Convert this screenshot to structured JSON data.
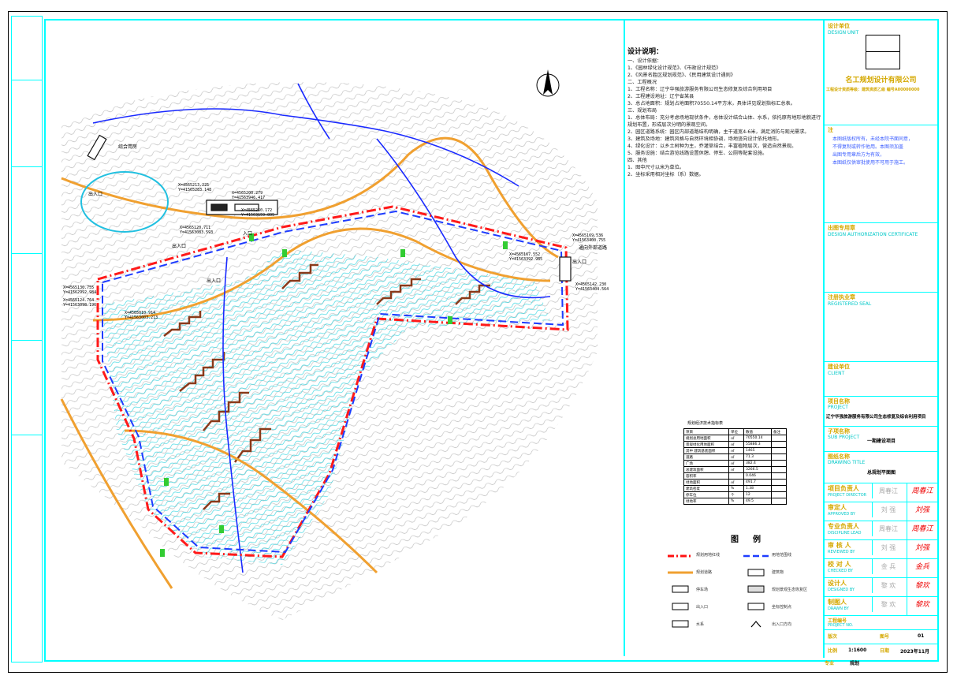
{
  "map": {
    "north_arrow": "N",
    "coords": [
      "X=4565213.225",
      "Y=41565283.148",
      "X=4565200.279",
      "Y=41563946.417",
      "X=4565250.172",
      "Y=41563159.895",
      "X=4565120.711",
      "Y=41563083.593",
      "X=4565169.536",
      "Y=41563400.755",
      "X=4565167.552",
      "Y=41563392.985",
      "X=4565142.230",
      "Y=41563404.564",
      "X=4565130.755",
      "Y=41562992.984",
      "X=4565124.764",
      "Y=41563098.196",
      "X=4565010.914",
      "Y=41563003.213"
    ],
    "labels": [
      "综合用房",
      "入口",
      "出入口",
      "出入口",
      "出入口",
      "出入口",
      "通向外部道路"
    ]
  },
  "notes": {
    "title": "设计说明：",
    "sections": [
      "一、设计依据：",
      "1、《园林绿化设计规范》、《市政设计规范》",
      "2、《风景名胜区规划规范》、《民用建筑设计通则》",
      "二、工程概况",
      "1、工程名称：辽宁华强旅游服务有限公司生态修复及综合利用项目",
      "2、工程建设地址：辽宁省某县",
      "3、总占地面积：规划占地面积70550.14平方米，具体详见规划指标汇总表。",
      "三、规划布局",
      "1、总体布局：充分考虑场地现状条件，总体设计结合山体、水系，依托原有地形地貌进行规划布置，形成层次分明的景观空间。",
      "2、园区道路系统：园区内部道路结构明确，主干道宽4-6米，满足消防与观光需求。",
      "3、建筑及场地：建筑风格与自然环境相协调，场地竖向设计依托地形。",
      "4、绿化设计：以乡土树种为主，乔灌草结合，丰富植物层次，营造自然景观。",
      "5、服务设施：结合游览线路设置休憩、停车、公厕等配套设施。",
      "四、其他",
      "1、图中尺寸以米为单位。",
      "2、坐标采用相对坐标（系）数据。"
    ]
  },
  "stats": {
    "title": "规划经济技术指标表",
    "header": [
      "项目",
      "单位",
      "数值",
      "备注"
    ],
    "rows": [
      [
        "规划总用地面积",
        "㎡",
        "70550.14",
        ""
      ],
      [
        "景观绿化用地面积",
        "㎡",
        "55886.3",
        ""
      ],
      [
        "其中 建筑基底面积",
        "㎡",
        "1465",
        ""
      ],
      [
        "道路",
        "㎡",
        "71.3",
        ""
      ],
      [
        "广场",
        "㎡",
        "382.4",
        ""
      ],
      [
        "总建筑面积",
        "㎡",
        "3266.5",
        ""
      ],
      [
        "容积率",
        "",
        "0.046",
        ""
      ],
      [
        "绿地面积",
        "㎡",
        "491.7",
        ""
      ],
      [
        "建筑密度",
        "%",
        "1.38",
        ""
      ],
      [
        "停车位",
        "个",
        "12",
        ""
      ],
      [
        "绿地率",
        "%",
        "49.5",
        ""
      ]
    ]
  },
  "legend": {
    "title": "图例",
    "items": [
      "规划用地红线",
      "用地范围线",
      "规划道路",
      "建筑物",
      "停车场",
      "规划景观生态恢复区",
      "出入口",
      "坐标控制点",
      "水系",
      "出入口方向"
    ]
  },
  "titleblock": {
    "design_unit_label": "设计单位",
    "design_unit_en": "DESIGN UNIT",
    "company": "名工规划设计有限公司",
    "cert": "工程设计资质等级：建筑资质乙级 编号A00000000",
    "notice_label": "注",
    "notice_lines": [
      "本图纸版权所有，未经本院书面同意，",
      "不得复制或转作他用。本图须加盖",
      "出图专用章后方为有效，",
      "本图纸仅供审批使用不可用于施工。"
    ],
    "approval_label": "出图专用章",
    "approval_en": "DESIGN AUTHORIZATION CERTIFICATE",
    "reg_label": "注册执业章",
    "reg_en": "REGISTERED SEAL",
    "owner_label": "建设单位",
    "owner_en": "CLIENT",
    "project_label": "项目名称",
    "project_en": "PROJECT",
    "project_name": "辽宁华强旅游服务有限公司生态修复及综合利用项目",
    "subitem_label": "子项名称",
    "subitem_en": "SUB PROJECT",
    "subitem": "一期建设项目",
    "drawing_label": "图纸名称",
    "drawing_en": "DRAWING TITLE",
    "drawing_title": "总规划平面图",
    "signatures": [
      {
        "role": "项目负责人",
        "role_en": "PROJECT DIRECTOR",
        "name": "周春江",
        "sign": "周春江"
      },
      {
        "role": "审定人",
        "role_en": "APPROVED BY",
        "name": "刘 强",
        "sign": "刘强"
      },
      {
        "role": "专业负责人",
        "role_en": "DISCIPLINE LEAD",
        "name": "周春江",
        "sign": "周春江"
      },
      {
        "role": "审 核 人",
        "role_en": "REVIEWED BY",
        "name": "刘 强",
        "sign": "刘强"
      },
      {
        "role": "校 对 人",
        "role_en": "CHECKED BY",
        "name": "金 兵",
        "sign": "金兵"
      },
      {
        "role": "设计人",
        "role_en": "DESIGNED BY",
        "name": "黎 欢",
        "sign": "黎欢"
      },
      {
        "role": "制图人",
        "role_en": "DRAWN BY",
        "name": "黎 欢",
        "sign": "黎欢"
      }
    ],
    "project_no_label": "工程编号",
    "project_no_en": "PROJECT NO.",
    "scale_label": "比例",
    "scale": "1:1600",
    "sheet_label": "图号",
    "sheet": "01",
    "date_label": "日期",
    "date": "2023年11月",
    "discipline_label": "专业",
    "discipline": "规划",
    "version_label": "版次"
  }
}
